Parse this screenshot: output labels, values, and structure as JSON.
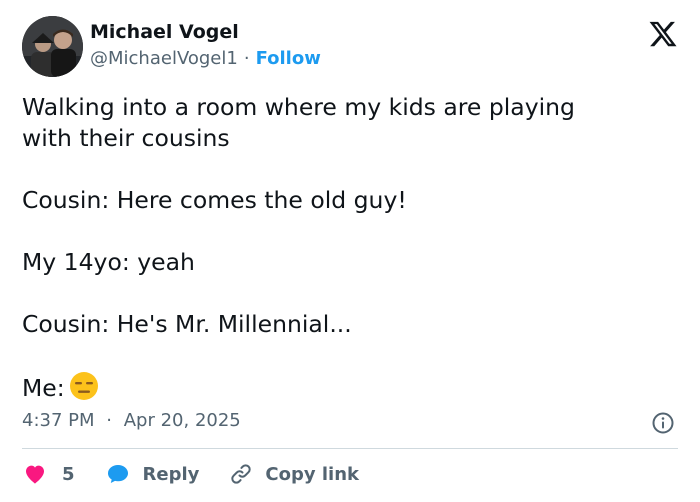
{
  "author": {
    "name": "Michael Vogel",
    "handle": "@MichaelVogel1",
    "separator": "·",
    "follow_label": "Follow"
  },
  "tweet": {
    "lines": [
      "Walking into a room where my kids are playing",
      "with their cousins",
      "Cousin: Here comes the old guy!",
      "My 14yo: yeah",
      "Cousin: He's Mr. Millennial...",
      "Me:"
    ],
    "emoji": "expressionless-face-emoji"
  },
  "timestamp": {
    "time": "4:37 PM",
    "separator": "·",
    "date": "Apr 20, 2025"
  },
  "actions": {
    "like_count": "5",
    "reply_label": "Reply",
    "copy_link_label": "Copy link"
  },
  "colors": {
    "text": "#0f1419",
    "muted": "#536471",
    "link": "#1d9bf0",
    "like": "#f91880",
    "reply_icon": "#1d9bf0",
    "divider": "#cfd9de"
  },
  "icons": {
    "brand": "x-logo-icon",
    "info": "info-icon",
    "like": "heart-icon",
    "reply": "speech-bubble-icon",
    "copy": "link-icon"
  }
}
